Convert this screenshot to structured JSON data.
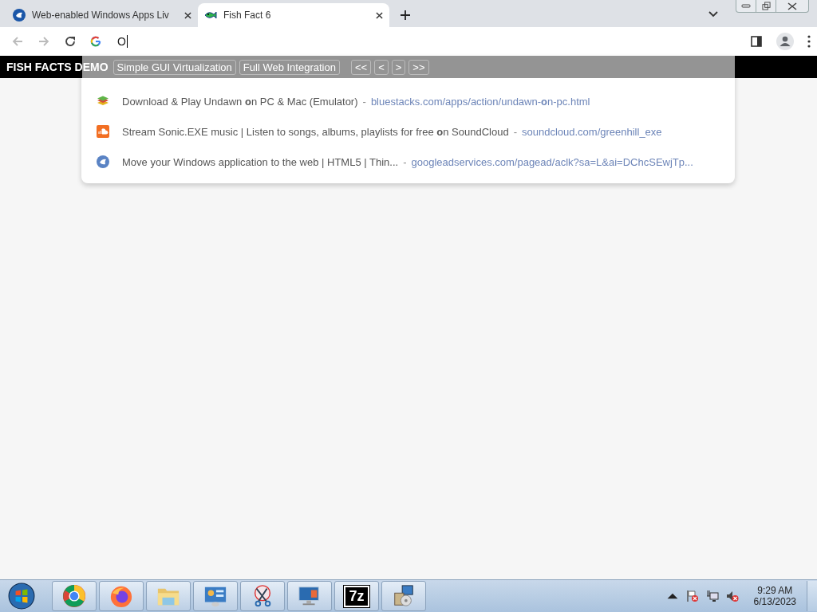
{
  "tabs": [
    {
      "title": "Web-enabled Windows Apps Liv",
      "kind": "circle",
      "selected": false
    },
    {
      "title": "Fish Fact 6",
      "kind": "fish",
      "selected": true
    }
  ],
  "omnibox": {
    "value": "O"
  },
  "suggestions": [
    {
      "kind": "bluestacks",
      "title": "Download & Play Undawn **o**n PC & Mac (Emulator)",
      "separator": "-",
      "url": "bluestacks.com/apps/action/undawn-**o**n-pc.html"
    },
    {
      "kind": "soundcloud",
      "title": "Stream Sonic.EXE music | Listen to songs, albums, playlists for free **o**n SoundCloud",
      "separator": "-",
      "url": "soundcloud.com/greenhill_exe"
    },
    {
      "kind": "circle",
      "title": "Move your Windows application to the web | HTML5 | Thin...",
      "separator": "-",
      "url": "googleadservices.com/pagead/aclk?sa=L&ai=DChcSEwjTp..."
    }
  ],
  "page_bar": {
    "title": "FISH FACTS DEMO",
    "buttons": [
      "Simple GUI Virtualization",
      "Full Web Integration",
      "<<",
      "<",
      ">",
      ">>"
    ]
  },
  "taskbar": {
    "items": [
      {
        "kind": "chrome"
      },
      {
        "kind": "firefox"
      },
      {
        "kind": "folder"
      },
      {
        "kind": "control"
      },
      {
        "kind": "snip"
      },
      {
        "kind": "remote"
      },
      {
        "kind": "archiver",
        "label": "7z"
      },
      {
        "kind": "installer"
      }
    ],
    "clock": {
      "time": "9:29 AM",
      "date": "6/13/2023"
    }
  }
}
